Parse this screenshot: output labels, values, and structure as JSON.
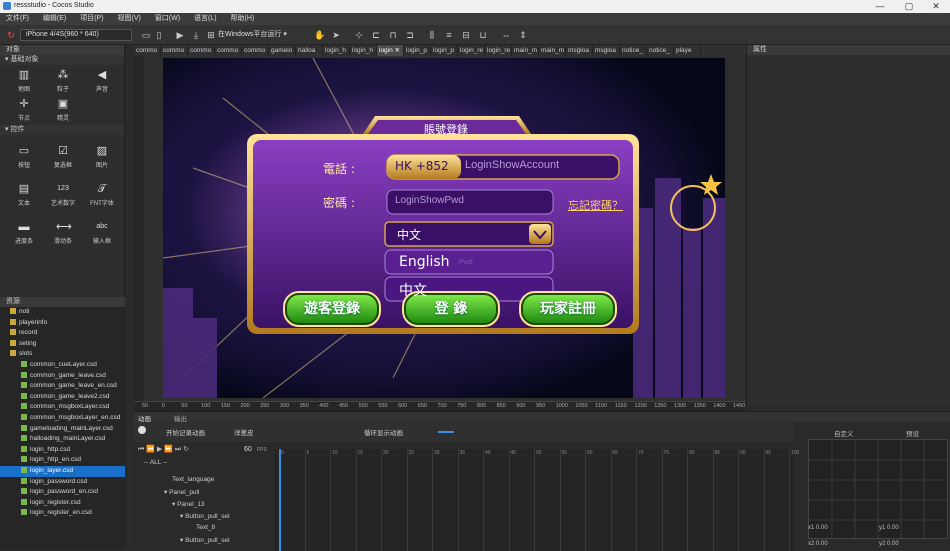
{
  "window": {
    "title": "ressstudio - Cocos Studio",
    "controls": [
      "—",
      "▢",
      "✕"
    ]
  },
  "menu": [
    "文件(F)",
    "编辑(E)",
    "项目(P)",
    "视图(V)",
    "窗口(W)",
    "语言(L)",
    "帮助(H)"
  ],
  "toolbar": {
    "device": "iPhone 4/4S(960 * 640)",
    "run_windows": "在Windows平台运行 ▾"
  },
  "objects_panel": {
    "title": "对象",
    "basic_section": "基础对象",
    "basic_items": [
      "地图",
      "粒子",
      "声音",
      "节点",
      "精灵"
    ],
    "controls_section": "控件",
    "control_items": [
      "按钮",
      "复选框",
      "图片",
      "文本",
      "艺术数字",
      "FNT字体",
      "进度条",
      "滑动条",
      "输入框"
    ]
  },
  "resources_panel": {
    "title": "资源",
    "items": [
      {
        "name": "noti",
        "type": "folder"
      },
      {
        "name": "playerinfo",
        "type": "folder"
      },
      {
        "name": "record",
        "type": "folder"
      },
      {
        "name": "seting",
        "type": "folder"
      },
      {
        "name": "slots",
        "type": "folder"
      },
      {
        "name": "common_cueLayer.csd",
        "type": "csd"
      },
      {
        "name": "common_game_leave.csd",
        "type": "csd"
      },
      {
        "name": "common_game_leave_en.csd",
        "type": "csd"
      },
      {
        "name": "common_game_leave2.csd",
        "type": "csd"
      },
      {
        "name": "common_msgboxLayer.csd",
        "type": "csd"
      },
      {
        "name": "common_msgboxLayer_en.csd",
        "type": "csd"
      },
      {
        "name": "gameloading_mainLayer.csd",
        "type": "csd"
      },
      {
        "name": "halloading_mainLayer.csd",
        "type": "csd"
      },
      {
        "name": "login_http.csd",
        "type": "csd"
      },
      {
        "name": "login_http_en.csd",
        "type": "csd"
      },
      {
        "name": "login_layer.csd",
        "type": "csd",
        "selected": true
      },
      {
        "name": "login_password.csd",
        "type": "csd"
      },
      {
        "name": "login_password_en.csd",
        "type": "csd"
      },
      {
        "name": "login_register.csd",
        "type": "csd"
      },
      {
        "name": "login_register_en.csd",
        "type": "csd"
      }
    ]
  },
  "tabs": [
    "commo",
    "commo",
    "commo",
    "commo",
    "commo",
    "gamelo",
    "halloa",
    "login_h",
    "login_h",
    "login ✕",
    "login_p",
    "login_p",
    "login_re",
    "login_re",
    "main_m",
    "main_m",
    "msgloa",
    "msgloa",
    "notice_",
    "notice_",
    "playe"
  ],
  "properties_panel": {
    "title": "属性"
  },
  "ruler_labels": [
    "50",
    "0",
    "50",
    "100",
    "150",
    "200",
    "250",
    "300",
    "350",
    "400",
    "450",
    "500",
    "550",
    "600",
    "650",
    "700",
    "750",
    "800",
    "850",
    "900",
    "950",
    "1000",
    "1050",
    "1100",
    "1150",
    "1200",
    "1250",
    "1300",
    "1350",
    "1400",
    "1450"
  ],
  "login_ui": {
    "header": "賬號登錄",
    "phone_label": "電話 :",
    "country_code": "HK +852",
    "account_placeholder": "LoginShowAccount",
    "password_label": "密碼 :",
    "password_placeholder": "LoginShowPwd",
    "forgot_link": "忘記密碼？",
    "language_selected": "中文",
    "language_options": [
      "English",
      "中文"
    ],
    "language_hint": "Pwd",
    "guest_button": "遊客登錄",
    "login_button": "登 錄",
    "register_button": "玩家註冊"
  },
  "bottom_panel": {
    "tabs": [
      "动画",
      "输出"
    ],
    "record_label": "开始记录动画",
    "onion_label": "洋葱皮",
    "loop_label": "循环显示动画",
    "fps": "60",
    "fps_unit": "FPS",
    "all_filter": "-- ALL --",
    "tree": [
      "Text_language",
      "Panel_pull",
      "Panel_13",
      "Button_pull_sel",
      "Text_8",
      "Button_pull_sel"
    ],
    "timeline_labels": [
      "0",
      "5",
      "10",
      "15",
      "20",
      "25",
      "30",
      "35",
      "40",
      "45",
      "50",
      "55",
      "60",
      "65",
      "70",
      "75",
      "80",
      "85",
      "90",
      "95",
      "100"
    ],
    "custom_label": "自定义",
    "preset_label": "预设",
    "x1": "x1  0.00",
    "y1": "y1  0.00",
    "x2": "x2  0.00",
    "y2": "y2  0.00"
  }
}
